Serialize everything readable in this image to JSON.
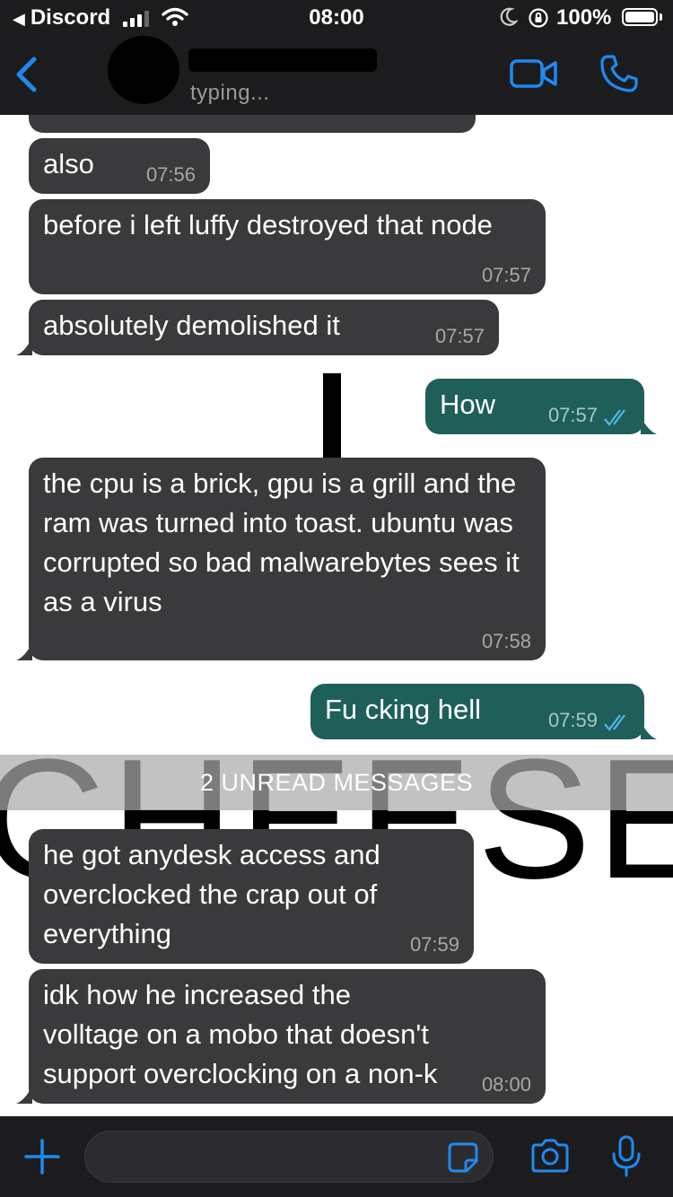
{
  "status_bar": {
    "back_app": "Discord",
    "time": "08:00",
    "battery": "100%"
  },
  "header": {
    "contact_status": "typing..."
  },
  "colors": {
    "incoming_bubble": "#3a3a3c",
    "outgoing_bubble": "#1e5f5a",
    "accent_blue": "#1e8af0",
    "read_ticks": "#4fb6ec"
  },
  "messages": {
    "partial_time": "07:56",
    "m1": {
      "text": "also",
      "time": "07:56"
    },
    "m2": {
      "text": "before i left luffy destroyed that node",
      "time": "07:57"
    },
    "m3": {
      "text": "absolutely demolished it",
      "time": "07:57"
    },
    "m4": {
      "text": "How",
      "time": "07:57"
    },
    "m5": {
      "text": "the cpu is a brick, gpu is a grill and the ram was turned into toast. ubuntu was corrupted so bad malwarebytes sees it as a virus",
      "time": "07:58"
    },
    "m6": {
      "text": "Fu cking hell",
      "time": "07:59"
    },
    "m7": {
      "text": "he got anydesk access and overclocked the crap out of everything",
      "time": "07:59"
    },
    "m8": {
      "text": "idk how he increased the volltage on a mobo that doesn't support overclocking on a non-k cpu",
      "time": "08:00"
    }
  },
  "unread_banner": "2 UNREAD MESSAGES",
  "background_text": "CHEESE",
  "icons": {
    "back": "chevron-left-icon",
    "video": "video-camera-icon",
    "phone": "phone-icon",
    "plus": "plus-icon",
    "sticker": "sticker-icon",
    "camera": "camera-icon",
    "mic": "microphone-icon"
  }
}
